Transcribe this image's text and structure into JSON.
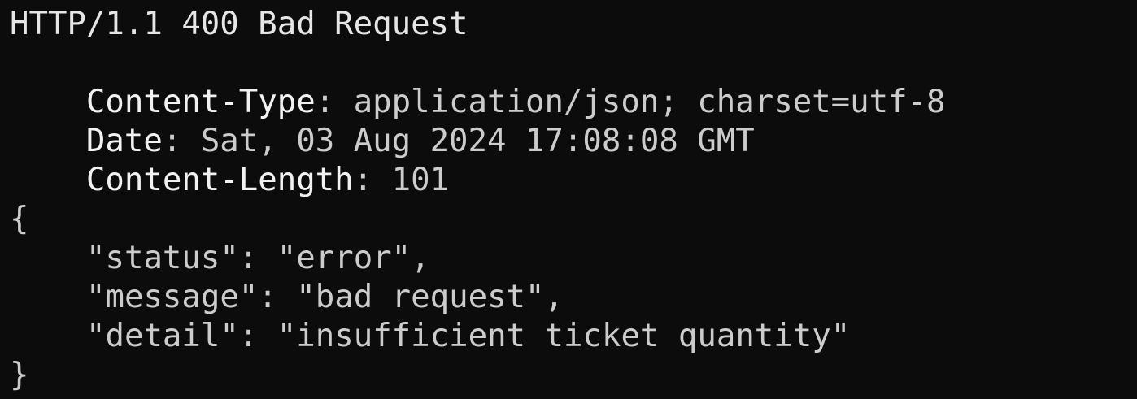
{
  "response": {
    "status_line": "HTTP/1.1 400 Bad Request",
    "headers": [
      {
        "name": "Content-Type",
        "value": "application/json; charset=utf-8"
      },
      {
        "name": "Date",
        "value": "Sat, 03 Aug 2024 17:08:08 GMT"
      },
      {
        "name": "Content-Length",
        "value": "101"
      }
    ],
    "header_separator": ": ",
    "body": {
      "open_brace": "{",
      "lines": [
        "\"status\": \"error\",",
        "\"message\": \"bad request\",",
        "\"detail\": \"insufficient ticket quantity\""
      ],
      "close_brace": "}"
    }
  },
  "colors": {
    "background": "#0c0c0c",
    "text": "#cccccc"
  }
}
